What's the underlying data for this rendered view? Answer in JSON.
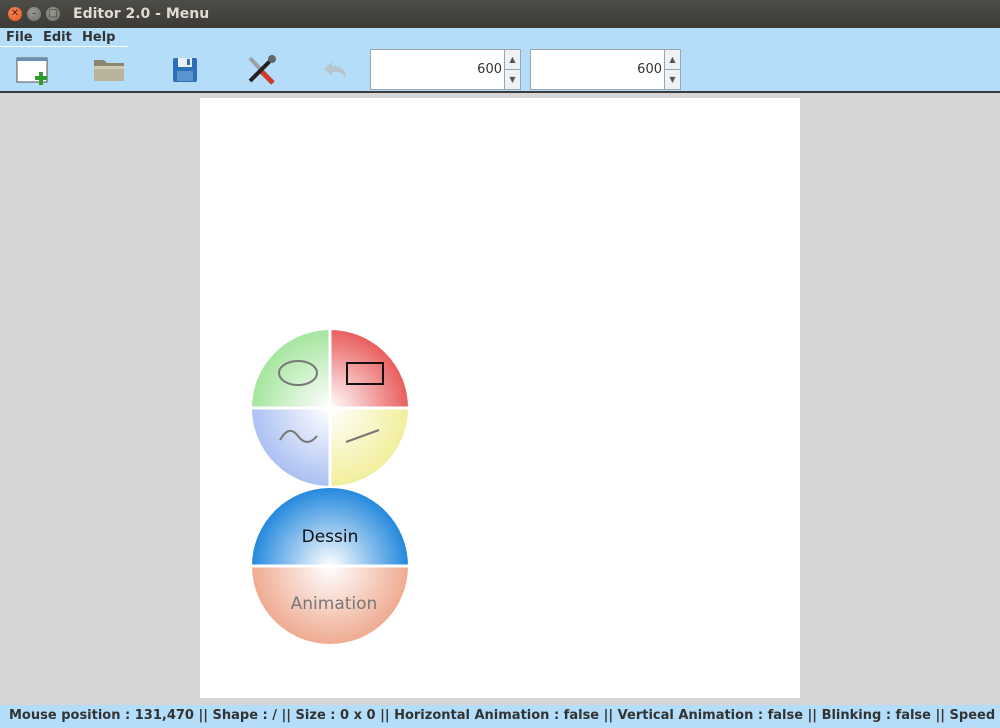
{
  "window": {
    "title": "Editor 2.0 - Menu"
  },
  "menu": [
    "File",
    "Edit",
    "Help"
  ],
  "toolbar": {
    "width_value": "600",
    "height_value": "600"
  },
  "wheel": {
    "shapes": [
      "ellipse",
      "rectangle",
      "freehand",
      "line"
    ],
    "mode_top_label": "Dessin",
    "mode_bottom_label": "Animation"
  },
  "status": {
    "text": "Mouse position : 131,470 ||  Shape : / ||  Size : 0 x 0 ||  Horizontal Animation : false ||  Vertical Animation : false ||  Blinking : false ||  Speed : /"
  },
  "colors": {
    "bar_blue": "#b3ddf8",
    "quad_green": "#aee8a6",
    "quad_red": "#ec6a6a",
    "quad_blue": "#b4c8f3",
    "quad_yellow": "#f4f1a6",
    "mode_blue": "#2b8ee0",
    "mode_salmon": "#f2b49a"
  }
}
